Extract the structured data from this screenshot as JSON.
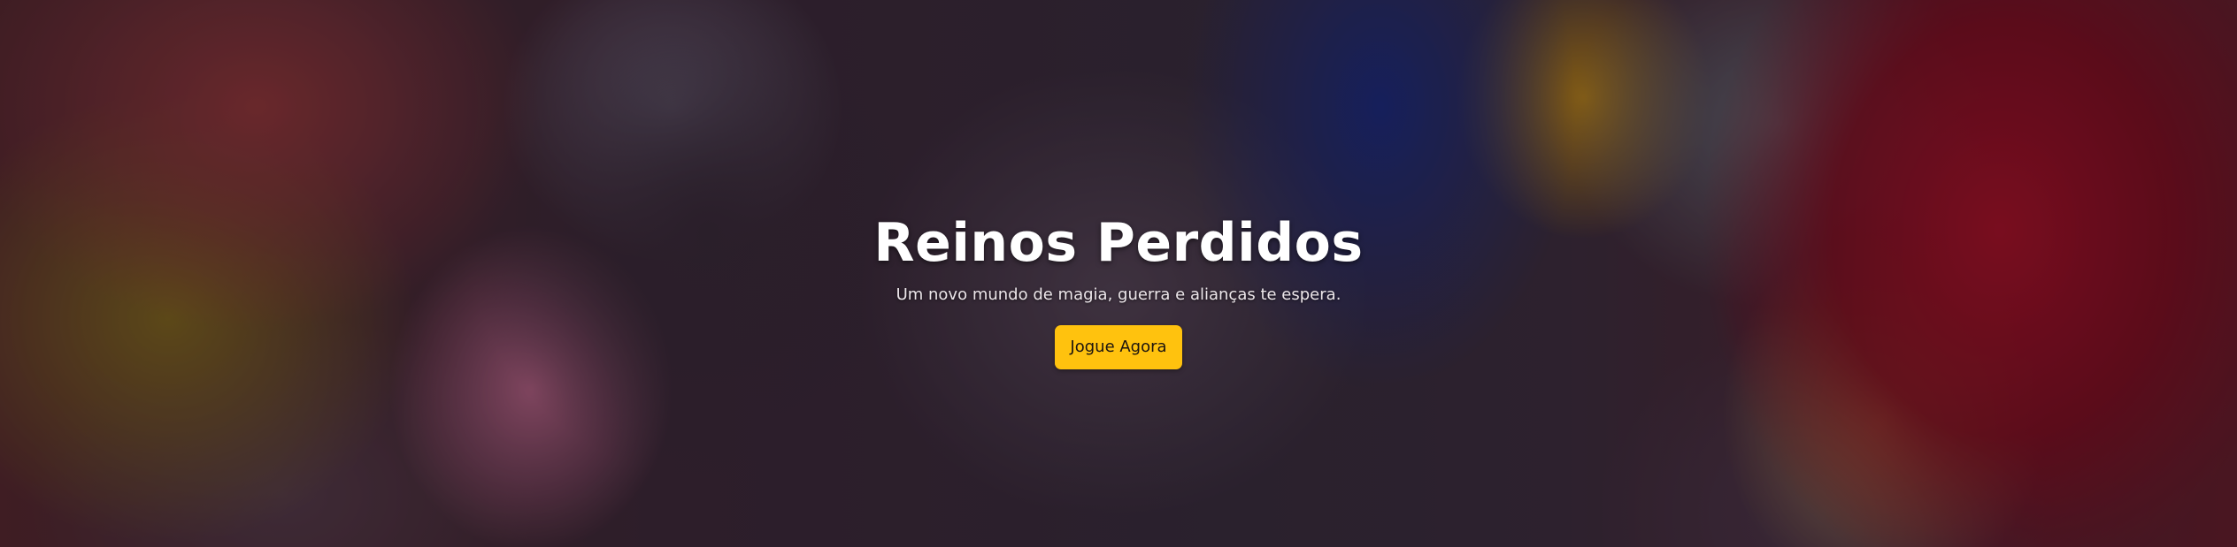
{
  "hero": {
    "background": "fantasy-heroes-artwork",
    "title": "Reinos Perdidos",
    "subtitle": "Um novo mundo de magia, guerra e alianças te espera.",
    "cta_label": "Jogue Agora"
  },
  "colors": {
    "cta_background": "#ffc20e",
    "cta_text": "#1b1410",
    "title_text": "#ffffff",
    "overlay": "#0f0a0f"
  }
}
